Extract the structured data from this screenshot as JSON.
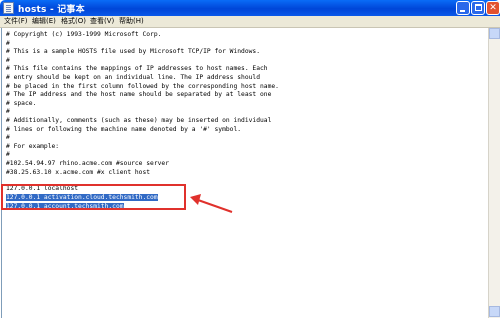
{
  "window": {
    "title": "hosts - 记事本",
    "controls": {
      "minimize": "minimize-icon",
      "maximize": "maximize-icon",
      "close": "✕"
    }
  },
  "menu": [
    {
      "label": "文件(F)"
    },
    {
      "label": "编辑(E)"
    },
    {
      "label": "格式(O)"
    },
    {
      "label": "查看(V)"
    },
    {
      "label": "帮助(H)"
    }
  ],
  "editor": {
    "lines": [
      "# Copyright (c) 1993-1999 Microsoft Corp.",
      "#",
      "# This is a sample HOSTS file used by Microsoft TCP/IP for Windows.",
      "#",
      "# This file contains the mappings of IP addresses to host names. Each",
      "# entry should be kept on an individual line. The IP address should",
      "# be placed in the first column followed by the corresponding host name.",
      "# The IP address and the host name should be separated by at least one",
      "# space.",
      "#",
      "# Additionally, comments (such as these) may be inserted on individual",
      "# lines or following the machine name denoted by a '#' symbol.",
      "#",
      "# For example:",
      "#",
      "#102.54.94.97 rhino.acme.com #source server",
      "#38.25.63.10 x.acme.com #x client host",
      "",
      "127.0.0.1 localhost",
      "127.0.0.1 activation.cloud.techsmith.com",
      "127.0.0.1 account.techsmith.com"
    ],
    "selected_lines": [
      19,
      20
    ]
  },
  "annotation": {
    "box_color": "#e0312c",
    "arrow_color": "#e0312c"
  },
  "colors": {
    "titlebar": "#0046d8",
    "selection": "#316ac5"
  }
}
